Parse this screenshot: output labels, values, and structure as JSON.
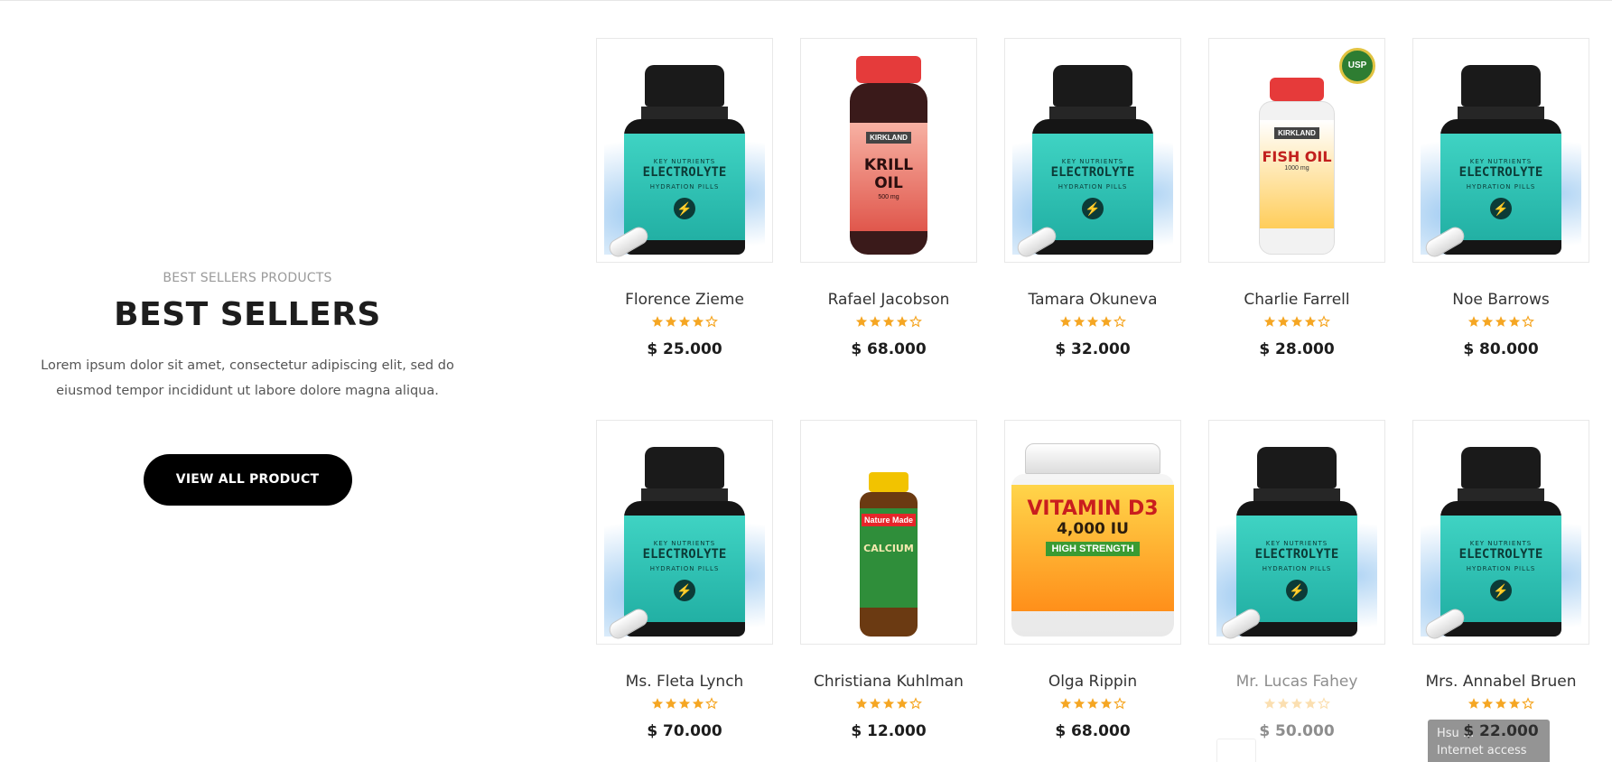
{
  "intro": {
    "eyebrow": "BEST SELLERS PRODUCTS",
    "title": "BEST SELLERS",
    "description": "Lorem ipsum dolor sit amet, consectetur adipiscing elit, sed do eiusmod tempor incididunt ut labore dolore magna aliqua.",
    "button_label": "VIEW ALL PRODUCT"
  },
  "products": [
    {
      "name": "Florence Zieme",
      "price": "$ 25.000",
      "rating": 4,
      "image": "electrolyte-bottle"
    },
    {
      "name": "Rafael Jacobson",
      "price": "$ 68.000",
      "rating": 4,
      "image": "krill-oil-bottle"
    },
    {
      "name": "Tamara Okuneva",
      "price": "$ 32.000",
      "rating": 4,
      "image": "electrolyte-bottle"
    },
    {
      "name": "Charlie Farrell",
      "price": "$ 28.000",
      "rating": 4,
      "image": "fish-oil-bottle"
    },
    {
      "name": "Noe Barrows",
      "price": "$ 80.000",
      "rating": 4,
      "image": "electrolyte-bottle"
    },
    {
      "name": "Ms. Fleta Lynch",
      "price": "$ 70.000",
      "rating": 4,
      "image": "electrolyte-bottle"
    },
    {
      "name": "Christiana Kuhlman",
      "price": "$ 12.000",
      "rating": 4,
      "image": "calcium-bottle"
    },
    {
      "name": "Olga Rippin",
      "price": "$ 68.000",
      "rating": 4,
      "image": "vitamin-d3-bottle"
    },
    {
      "name": "Mr. Lucas Fahey",
      "price": "$ 50.000",
      "rating": 4,
      "image": "electrolyte-bottle"
    },
    {
      "name": "Mrs. Annabel Bruen",
      "price": "$ 22.000",
      "rating": 4,
      "image": "electrolyte-bottle"
    }
  ],
  "labels": {
    "electrolyte": {
      "brand": "KEY NUTRIENTS",
      "title": "ELECTROLYTE",
      "sub": "HYDRATION PILLS"
    },
    "krill": {
      "brand": "KIRKLAND",
      "title": "KRILL OIL",
      "sub": "500 mg"
    },
    "fish": {
      "brand": "KIRKLAND",
      "title": "FISH OIL",
      "sub": "1000 mg",
      "badge": "USP"
    },
    "calcium": {
      "brand": "Nature Made",
      "title": "CALCIUM"
    },
    "vitd": {
      "title": "VITAMIN D3",
      "sub": "4,000 IU",
      "tag": "HIGH STRENGTH"
    }
  },
  "toast": {
    "line1": "Hsu ...",
    "line2": "Internet access"
  },
  "colors": {
    "star": "#f5a623",
    "button": "#000000",
    "accent_teal": "#2fc3b5"
  }
}
